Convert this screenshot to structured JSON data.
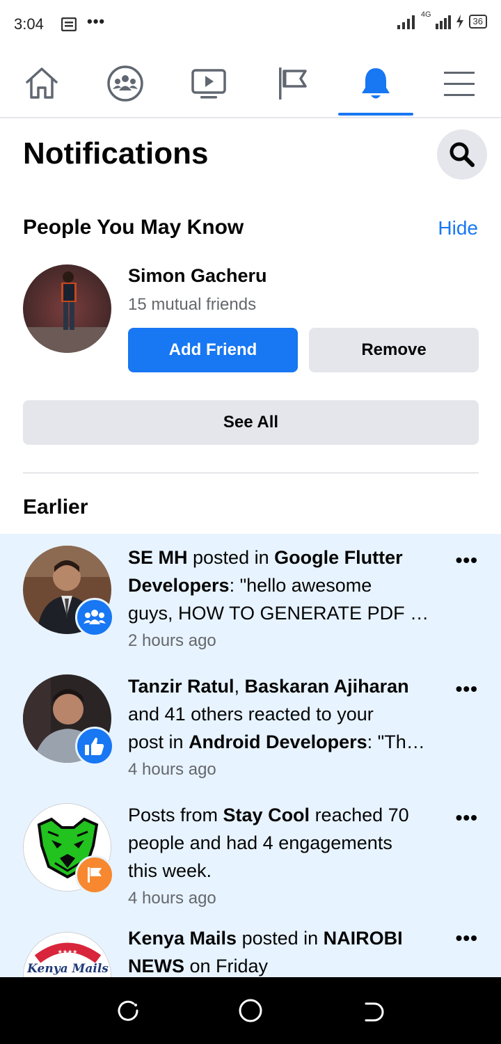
{
  "status_bar": {
    "time": "3:04",
    "dots": "•••",
    "network": "4G",
    "battery": "36"
  },
  "nav": {
    "tabs": [
      "home",
      "groups",
      "watch",
      "pages",
      "notifications",
      "menu"
    ],
    "active": "notifications"
  },
  "header": {
    "title": "Notifications"
  },
  "pymk": {
    "title": "People You May Know",
    "hide_label": "Hide",
    "person": {
      "name": "Simon Gacheru",
      "mutual": "15 mutual friends"
    },
    "add_label": "Add Friend",
    "remove_label": "Remove",
    "see_all_label": "See All"
  },
  "earlier": {
    "title": "Earlier",
    "items": [
      {
        "lines": [
          [
            {
              "t": "SE MH",
              "b": true
            },
            {
              "t": " posted in ",
              "b": false
            },
            {
              "t": "Google Flutter",
              "b": true
            }
          ],
          [
            {
              "t": "Developers",
              "b": true
            },
            {
              "t": ": \"hello awesome",
              "b": false
            }
          ],
          [
            {
              "t": "guys, HOW TO GENERATE PDF …",
              "b": false
            }
          ]
        ],
        "time": "2 hours ago",
        "badge": "groups-icon",
        "more": "•••"
      },
      {
        "lines": [
          [
            {
              "t": "Tanzir Ratul",
              "b": true
            },
            {
              "t": ", ",
              "b": false
            },
            {
              "t": "Baskaran Ajiharan",
              "b": true
            }
          ],
          [
            {
              "t": "and 41 others reacted to your",
              "b": false
            }
          ],
          [
            {
              "t": "post in ",
              "b": false
            },
            {
              "t": "Android Developers",
              "b": true
            },
            {
              "t": ": \"Th…",
              "b": false
            }
          ]
        ],
        "time": "4 hours ago",
        "badge": "like-icon",
        "more": "•••"
      },
      {
        "lines": [
          [
            {
              "t": "Posts from ",
              "b": false
            },
            {
              "t": "Stay Cool",
              "b": true
            },
            {
              "t": " reached 70",
              "b": false
            }
          ],
          [
            {
              "t": "people and had 4 engagements",
              "b": false
            }
          ],
          [
            {
              "t": "this week.",
              "b": false
            }
          ]
        ],
        "time": "4 hours ago",
        "badge": "flag-icon",
        "more": "•••"
      },
      {
        "lines": [
          [
            {
              "t": "Kenya Mails",
              "b": true
            },
            {
              "t": " posted in ",
              "b": false
            },
            {
              "t": "NAIROBI",
              "b": true
            }
          ],
          [
            {
              "t": "NEWS",
              "b": true
            },
            {
              "t": " on Friday",
              "b": false
            }
          ]
        ],
        "time": "",
        "badge": "",
        "more": "•••",
        "avatar_label": "Kenya Mails"
      }
    ]
  },
  "colors": {
    "accent": "#1877f2",
    "highlight_bg": "#e7f3ff",
    "secondary_btn": "#e4e6eb",
    "muted_text": "#65676b"
  }
}
